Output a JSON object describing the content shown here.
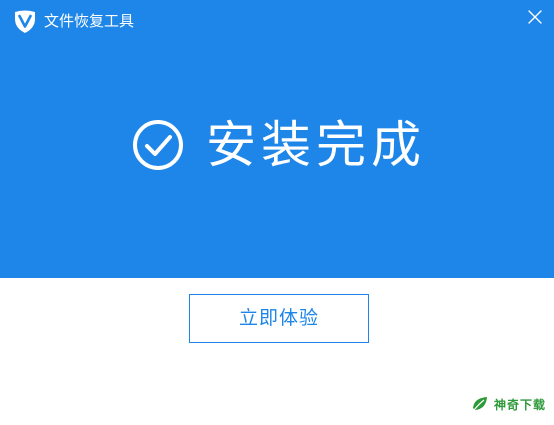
{
  "window": {
    "title": "文件恢复工具",
    "logo_icon": "v-shield-logo-icon",
    "close_icon": "close-icon"
  },
  "banner": {
    "background_color": "#1d86e8",
    "status_icon": "check-circle-icon",
    "status_text": "安装完成"
  },
  "actions": {
    "primary_label": "立即体验"
  },
  "watermark": {
    "icon": "leaf-logo-icon",
    "text": "神奇下载",
    "color": "#2e9a3a"
  }
}
